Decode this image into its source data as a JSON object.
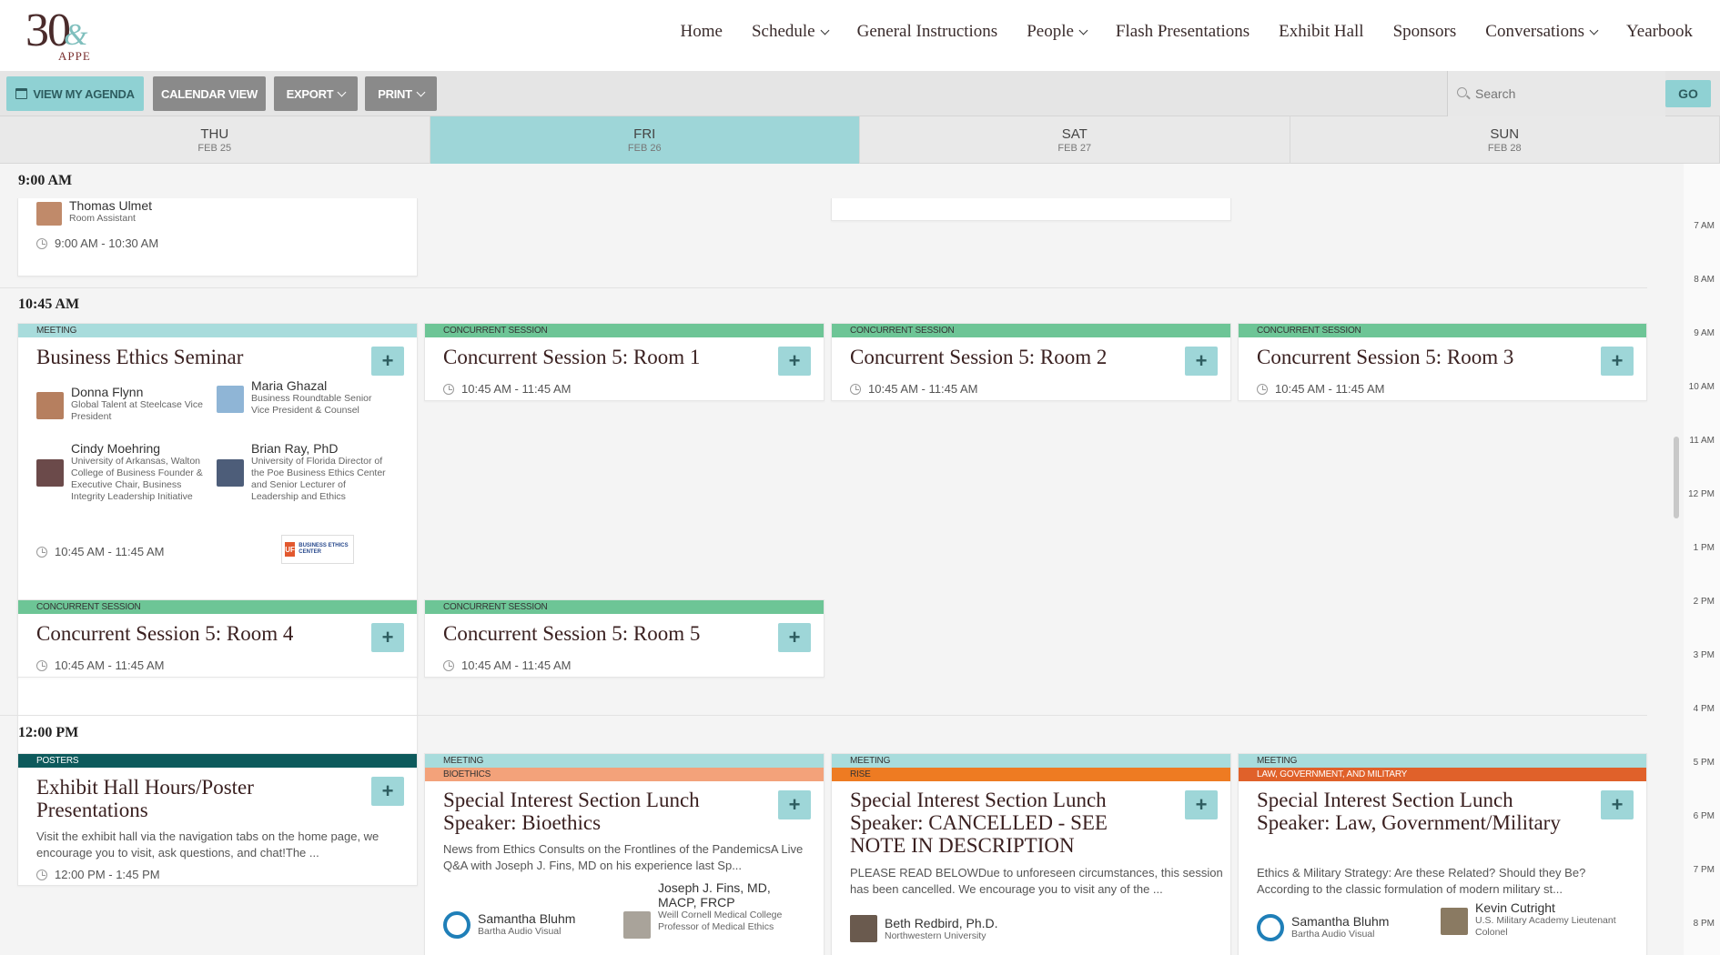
{
  "logo": {
    "number": "30",
    "amp": "&",
    "org": "APPE"
  },
  "nav": [
    {
      "label": "Home",
      "dropdown": false
    },
    {
      "label": "Schedule",
      "dropdown": true
    },
    {
      "label": "General Instructions",
      "dropdown": false
    },
    {
      "label": "People",
      "dropdown": true
    },
    {
      "label": "Flash Presentations",
      "dropdown": false
    },
    {
      "label": "Exhibit Hall",
      "dropdown": false
    },
    {
      "label": "Sponsors",
      "dropdown": false
    },
    {
      "label": "Conversations",
      "dropdown": true
    },
    {
      "label": "Yearbook",
      "dropdown": false
    }
  ],
  "toolbar": {
    "view_agenda": "VIEW MY AGENDA",
    "calendar_view": "CALENDAR VIEW",
    "export": "EXPORT",
    "print": "PRINT",
    "search_placeholder": "Search",
    "go": "GO"
  },
  "days": [
    {
      "name": "THU",
      "date": "FEB 25",
      "active": false
    },
    {
      "name": "FRI",
      "date": "FEB 26",
      "active": true
    },
    {
      "name": "SAT",
      "date": "FEB 27",
      "active": false
    },
    {
      "name": "SUN",
      "date": "FEB 28",
      "active": false
    }
  ],
  "slots": {
    "s900": "9:00 AM",
    "s1045": "10:45 AM",
    "s1200": "12:00 PM"
  },
  "early": {
    "person_name": "Thomas Ulmet",
    "person_role": "Room Assistant",
    "time": "9:00 AM - 10:30 AM"
  },
  "cards": {
    "bes": {
      "band": "MEETING",
      "title": "Business Ethics Seminar",
      "time": "10:45 AM - 11:45 AM",
      "people": [
        {
          "name": "Donna Flynn",
          "role": "Global Talent at Steelcase Vice President"
        },
        {
          "name": "Maria Ghazal",
          "role": "Business Roundtable Senior Vice President & Counsel"
        },
        {
          "name": "Cindy Moehring",
          "role": "University of Arkansas, Walton College of Business Founder & Executive Chair, Business Integrity Leadership Initiative"
        },
        {
          "name": "Brian Ray, PhD",
          "role": "University of Florida Director of the Poe Business Ethics Center and Senior Lecturer of Leadership and Ethics"
        }
      ],
      "badge_uf": "UF",
      "badge_text": "BUSINESS ETHICS CENTER"
    },
    "cs1": {
      "band": "CONCURRENT SESSION",
      "title": "Concurrent Session 5: Room 1",
      "time": "10:45 AM - 11:45 AM"
    },
    "cs2": {
      "band": "CONCURRENT SESSION",
      "title": "Concurrent Session 5: Room 2",
      "time": "10:45 AM - 11:45 AM"
    },
    "cs3": {
      "band": "CONCURRENT SESSION",
      "title": "Concurrent Session 5: Room 3",
      "time": "10:45 AM - 11:45 AM"
    },
    "cs4": {
      "band": "CONCURRENT SESSION",
      "title": "Concurrent Session 5: Room 4",
      "time": "10:45 AM - 11:45 AM"
    },
    "cs5": {
      "band": "CONCURRENT SESSION",
      "title": "Concurrent Session 5: Room 5",
      "time": "10:45 AM - 11:45 AM"
    },
    "exhibit": {
      "band": "POSTERS",
      "title": "Exhibit Hall Hours/Poster Presentations",
      "desc": "Visit the exhibit hall via the navigation tabs on the home page, we encourage you to visit, ask questions, and chat!The ...",
      "time": "12:00 PM - 1:45 PM"
    },
    "bioethics": {
      "band": "MEETING",
      "band2": "BIOETHICS",
      "title": "Special Interest Section Lunch Speaker: Bioethics",
      "desc": "News from Ethics Consults on the Frontlines of the PandemicsA Live Q&A with Joseph J. Fins, MD on his experience last Sp...",
      "p1_name": "Samantha Bluhm",
      "p1_role": "Bartha Audio Visual",
      "p2_name": "Joseph J. Fins, MD, MACP, FRCP",
      "p2_role": "Weill Cornell Medical College Professor of Medical Ethics"
    },
    "rise": {
      "band": "MEETING",
      "band2": "RISE",
      "title": "Special Interest Section Lunch Speaker: CANCELLED - SEE NOTE IN DESCRIPTION",
      "desc": "PLEASE READ BELOWDue to unforeseen circumstances, this session has been cancelled. We encourage you to visit any of the ...",
      "p1_name": "Beth Redbird, Ph.D.",
      "p1_role": "Northwestern University"
    },
    "law": {
      "band": "MEETING",
      "band2": "LAW, GOVERNMENT, AND MILITARY",
      "title": "Special Interest Section Lunch Speaker: Law, Government/Military",
      "desc": "Ethics & Military Strategy: Are these Related? Should they Be? According to the classic formulation of modern military st...",
      "p1_name": "Samantha Bluhm",
      "p1_role": "Bartha Audio Visual",
      "p2_name": "Kevin Cutright",
      "p2_role": "U.S. Military Academy Lieutenant Colonel"
    }
  },
  "plus_label": "+",
  "timeline": [
    "7 AM",
    "8 AM",
    "9 AM",
    "10 AM",
    "11 AM",
    "12 PM",
    "1 PM",
    "2 PM",
    "3 PM",
    "4 PM",
    "5 PM",
    "6 PM",
    "7 PM",
    "8 PM"
  ],
  "colors": {
    "accent": "#9ed6d8",
    "concurrent": "#6dc596",
    "posters": "#0d5a5c",
    "bioethics": "#f3a27a",
    "rise": "#ee7b22",
    "law": "#e0612a"
  }
}
